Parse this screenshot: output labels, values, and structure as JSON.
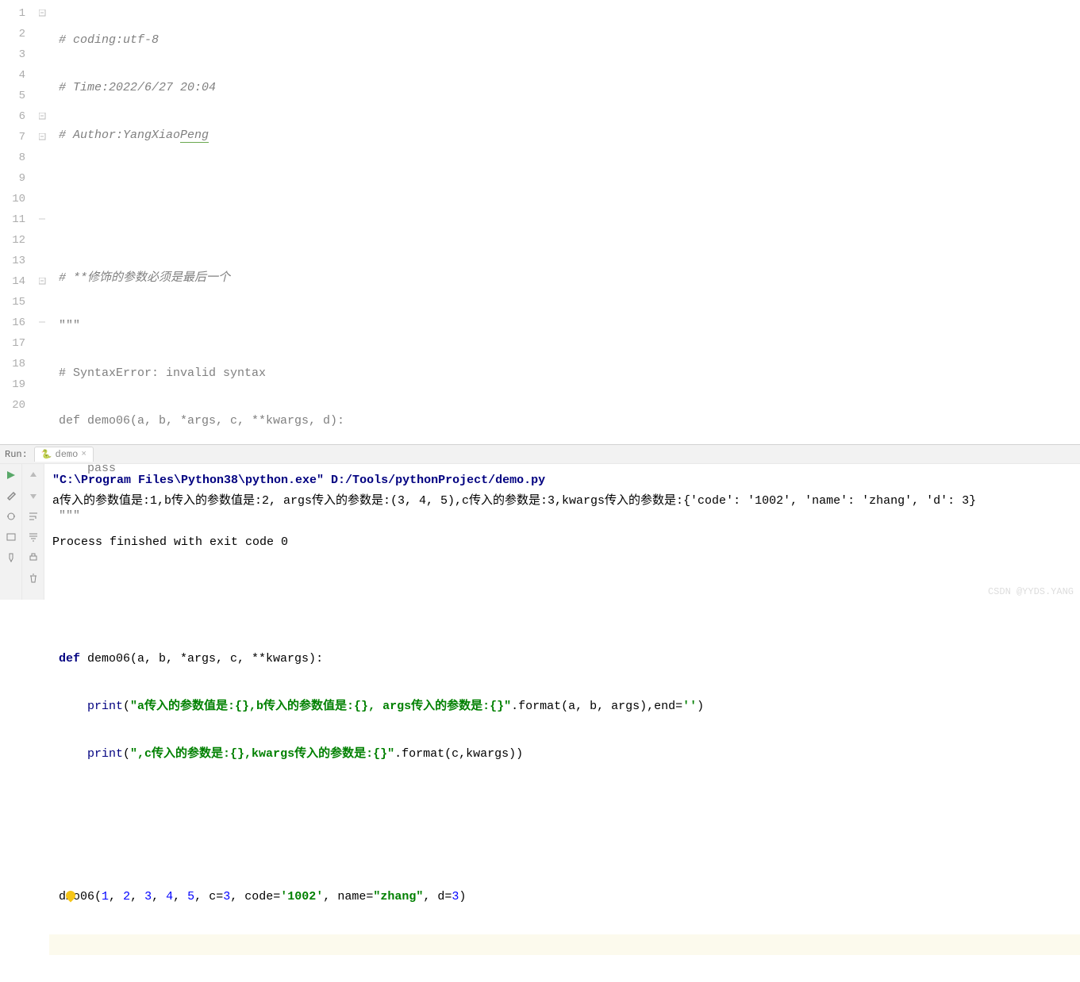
{
  "editor": {
    "lines": [
      1,
      2,
      3,
      4,
      5,
      6,
      7,
      8,
      9,
      10,
      11,
      12,
      13,
      14,
      15,
      16,
      17,
      18,
      19,
      20
    ],
    "code": {
      "l1": "# coding:utf-8",
      "l2": "# Time:2022/6/27 20:04",
      "l3_pre": "# Author:YangXiao",
      "l3_peng": "Peng",
      "l6": "# **修饰的参数必须是最后一个",
      "l7": "\"\"\"",
      "l8": "# SyntaxError: invalid syntax",
      "l9": "def demo06(a, b, *args, c, **kwargs, d):",
      "l10": "    pass",
      "l11": "\"\"\"",
      "l14_def": "def ",
      "l14_name": "demo06(a, b, *args, c, **kwargs):",
      "l15_indent": "    ",
      "l15_print": "print",
      "l15_p1": "(",
      "l15_s1": "\"a传入的参数值是:{},b传入的参数值是:{}, args传入的参数是:{}\"",
      "l15_fmt": ".format(a, b, args),",
      "l15_end": "end",
      "l15_eq": "=",
      "l15_q": "''",
      "l15_p2": ")",
      "l16_indent": "    ",
      "l16_print": "print",
      "l16_p1": "(",
      "l16_s1": "\",c传入的参数是:{},kwargs传入的参数是:{}\"",
      "l16_fmt": ".format(c,kwargs))",
      "l19_pre": "d",
      "l19_mid": "mo06(",
      "l19_n1": "1",
      "l19_c": ", ",
      "l19_n2": "2",
      "l19_n3": "3",
      "l19_n4": "4",
      "l19_n5": "5",
      "l19_ckw": "c",
      "l19_eq": "=",
      "l19_n3b": "3",
      "l19_code": "code",
      "l19_s1002": "'1002'",
      "l19_name": "name",
      "l19_szhang": "\"zhang\"",
      "l19_d": "d",
      "l19_n3c": "3",
      "l19_close": ")"
    }
  },
  "run": {
    "label": "Run:",
    "tab": "demo",
    "out1": "\"C:\\Program Files\\Python38\\python.exe\" D:/Tools/pythonProject/demo.py",
    "out2": "a传入的参数值是:1,b传入的参数值是:2, args传入的参数是:(3, 4, 5),c传入的参数是:3,kwargs传入的参数是:{'code': '1002', 'name': 'zhang', 'd': 3}",
    "out3": "Process finished with exit code 0"
  },
  "watermark": "CSDN @YYDS.YANG"
}
